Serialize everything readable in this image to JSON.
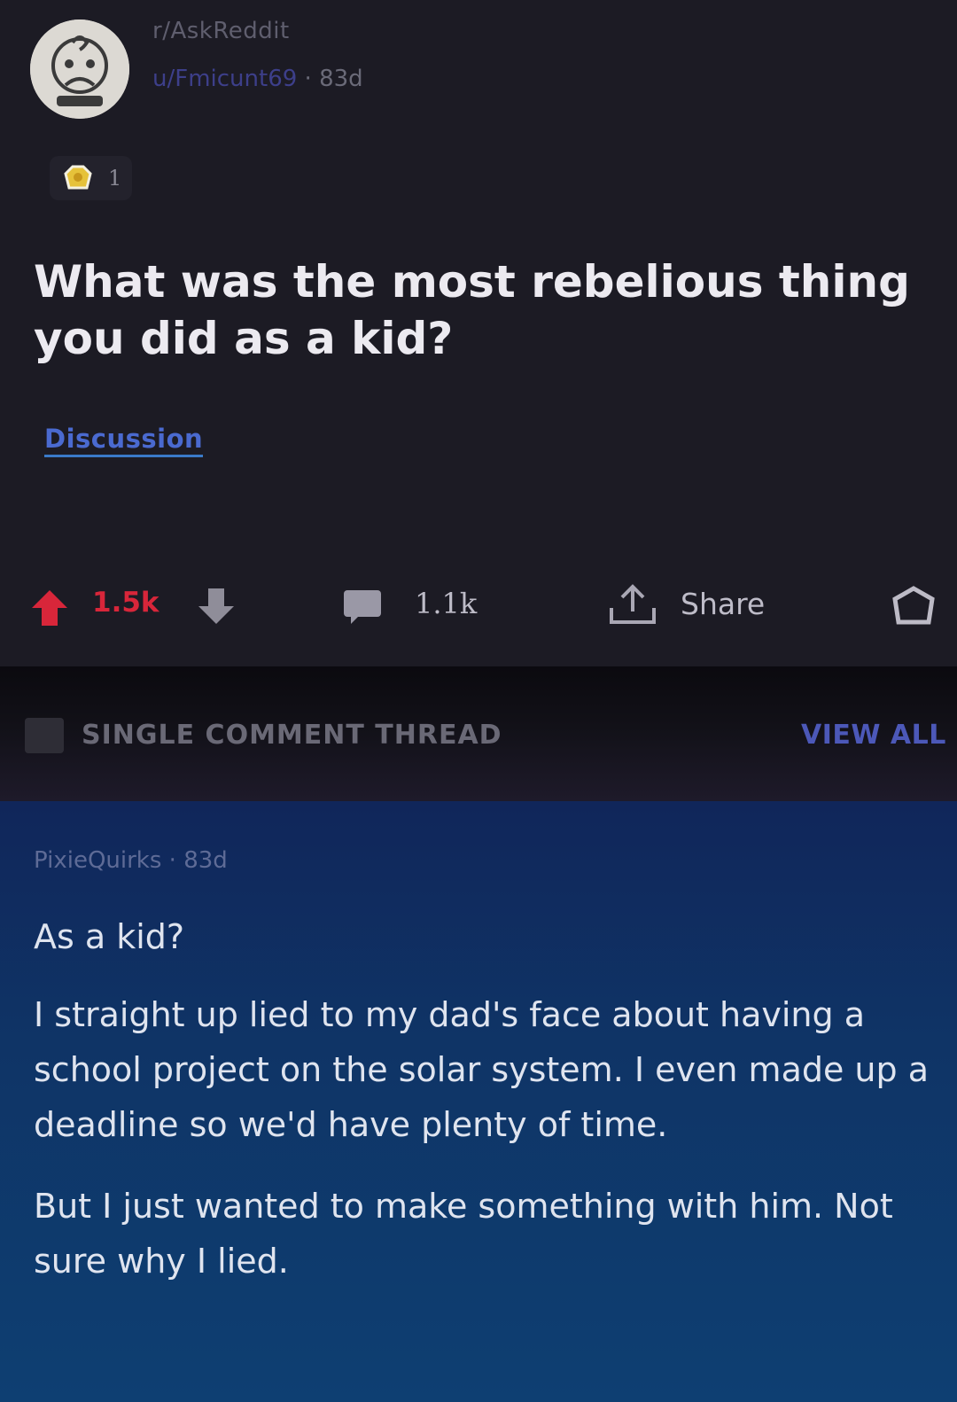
{
  "post": {
    "subreddit": "r/AskReddit",
    "author": "u/Fmicunt69",
    "age": "83d",
    "award_count": "1",
    "title": "What was the most rebelious thing you did as a kid?",
    "flair": "Discussion",
    "score": "1.5k",
    "comments": "1.1k",
    "share_label": "Share"
  },
  "thread_bar": {
    "label": "SINGLE COMMENT THREAD",
    "view_all": "VIEW ALL"
  },
  "comment": {
    "author": "PixieQuirks",
    "age": "83d",
    "paragraphs": [
      "As a kid?",
      "I straight up lied to my dad's face about having a school project on the solar system. I even made up a deadline so we'd have plenty of time.",
      "But I just wanted to make something with him. Not sure why I lied."
    ]
  },
  "colors": {
    "upvote": "#d8263a",
    "flair": "#4a6ad0",
    "comment_bg": "#0f3466"
  }
}
